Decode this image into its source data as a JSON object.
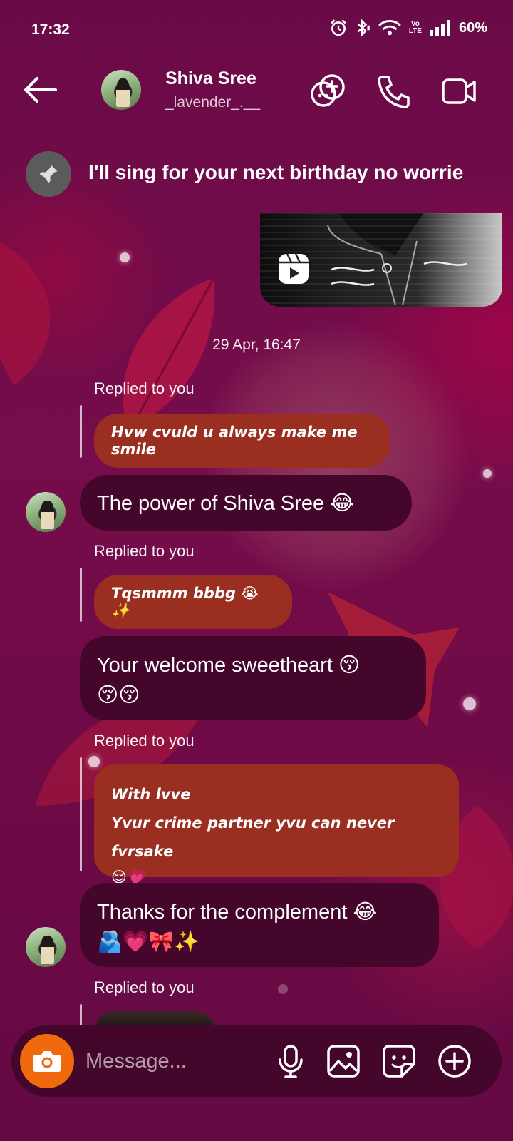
{
  "status_bar": {
    "time": "17:32",
    "lte_line1": "Vo",
    "lte_line2": "LTE",
    "battery": "60%"
  },
  "header": {
    "name": "Shiva Sree",
    "handle": "_lavender_.__"
  },
  "pinned": {
    "text": "I'll sing for your next birthday no worrie"
  },
  "timestamp": "29 Apr, 16:47",
  "messages": [
    {
      "replied_label": "Replied to you",
      "quote": "Hvw cvuld u always make me smile",
      "reply": "The power of Shiva Sree 😂"
    },
    {
      "replied_label": "Replied to you",
      "quote": "Tqsmmm bbbg 😭✨",
      "reply_line1": "Your welcome sweetheart 😚",
      "reply_line2": "😚😚"
    },
    {
      "replied_label": "Replied to you",
      "quote_line1": "With lvve",
      "quote_line2": "Yvur crime partner yvu can never fvrsake",
      "quote_line3": "😌💗",
      "reply_line1": "Thanks for the complement 😂",
      "reply_line2": "🫂💗🎀✨"
    },
    {
      "replied_label": "Replied to you"
    }
  ],
  "composer": {
    "placeholder": "Message..."
  },
  "icons": {
    "back": "back-arrow-icon",
    "effects": "face-effects-icon",
    "call": "phone-icon",
    "video": "video-camera-icon",
    "pin": "pin-icon",
    "reel": "reel-icon",
    "camera": "camera-icon",
    "mic": "microphone-icon",
    "gallery": "image-icon",
    "sticker": "sticker-icon",
    "more": "plus-circle-icon"
  },
  "colors": {
    "background": "#6b0a45",
    "bubble": "#45062b",
    "quote_bubble": "#9a2f21",
    "camera_button": "#f06a0d",
    "pin_circle": "#5b5b5b"
  }
}
